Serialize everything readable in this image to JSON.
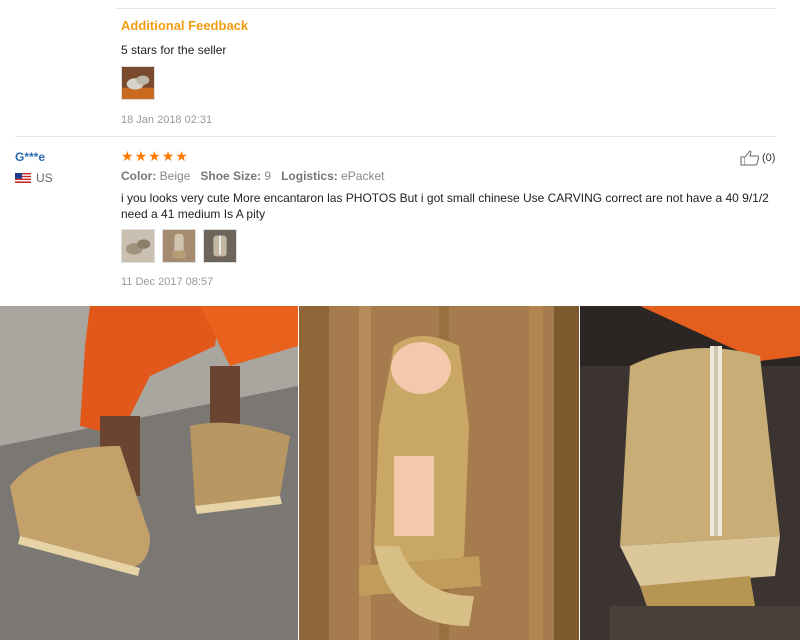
{
  "additional_feedback": {
    "title": "Additional Feedback",
    "text": "5 stars for the seller",
    "date": "18 Jan 2018 02:31"
  },
  "review": {
    "user": "G***e",
    "country": "US",
    "rating": 5,
    "color_label": "Color:",
    "color_value": "Beige",
    "size_label": "Shoe Size:",
    "size_value": "9",
    "logistics_label": "Logistics:",
    "logistics_value": "ePacket",
    "text": "i you looks very cute More encantaron las PHOTOS But i got small chinese Use CARVING correct are not have a 40 9/1/2 need a 41 medium Is A pity",
    "date": "11 Dec 2017 08:57",
    "likes": "(0)"
  },
  "colors": {
    "accent_orange": "#f39c12",
    "username_blue": "#2b6cb0",
    "star_orange": "#ff7a00"
  }
}
